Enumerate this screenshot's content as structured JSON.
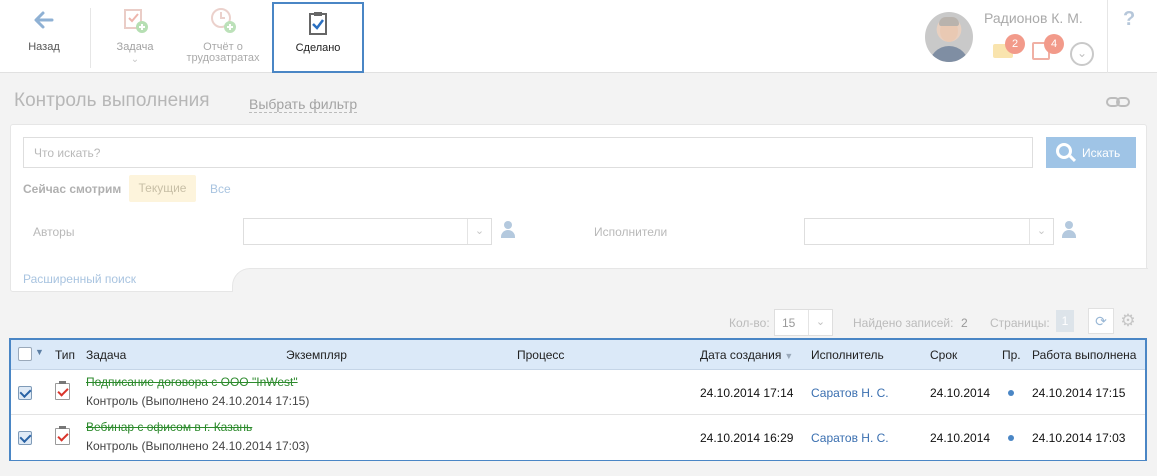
{
  "toolbar": {
    "back_label": "Назад",
    "task_label": "Задача",
    "report_label_line1": "Отчёт о",
    "report_label_line2": "трудозатратах",
    "done_label": "Сделано"
  },
  "user": {
    "name": "Радионов К. М.",
    "mail_count": "2",
    "task_count": "4"
  },
  "header": {
    "title": "Контроль выполнения",
    "filter_link": "Выбрать фильтр"
  },
  "filter": {
    "search_placeholder": "Что искать?",
    "search_button": "Искать",
    "now_viewing": "Сейчас смотрим",
    "chip_current": "Текущие",
    "chip_all": "Все",
    "authors_label": "Авторы",
    "performers_label": "Исполнители",
    "advanced_search": "Расширенный поиск"
  },
  "pagination": {
    "count_label": "Кол-во:",
    "count_value": "15",
    "found_label": "Найдено записей:",
    "found_value": "2",
    "pages_label": "Страницы:",
    "page_value": "1"
  },
  "table": {
    "columns": {
      "type": "Тип",
      "task": "Задача",
      "instance": "Экземпляр",
      "process": "Процесс",
      "created": "Дата создания",
      "performer": "Исполнитель",
      "deadline": "Срок",
      "priority": "Пр.",
      "completed": "Работа выполнена"
    },
    "rows": [
      {
        "title": "Подписание договора с ООО \"InWest\"",
        "subtitle": "Контроль (Выполнено 24.10.2014 17:15)",
        "created": "24.10.2014 17:14",
        "performer": "Саратов Н. С.",
        "deadline": "24.10.2014",
        "completed": "24.10.2014 17:15",
        "checked": true
      },
      {
        "title": "Вебинар с офисом в г. Казань",
        "subtitle": "Контроль (Выполнено 24.10.2014 17:03)",
        "created": "24.10.2014 16:29",
        "performer": "Саратов Н. С.",
        "deadline": "24.10.2014",
        "completed": "24.10.2014 17:03",
        "checked": true
      }
    ]
  },
  "icons": {
    "back": "arrow-left-icon",
    "task": "task-add-icon",
    "report": "clock-add-icon",
    "done": "clipboard-check-icon",
    "link": "link-icon",
    "refresh": "refresh-icon",
    "settings": "gear-icon"
  },
  "colors": {
    "accent": "#4a86c5",
    "header_bg": "#dbe9f8",
    "done_title": "#2c8a2c",
    "link": "#3a6fb0"
  }
}
